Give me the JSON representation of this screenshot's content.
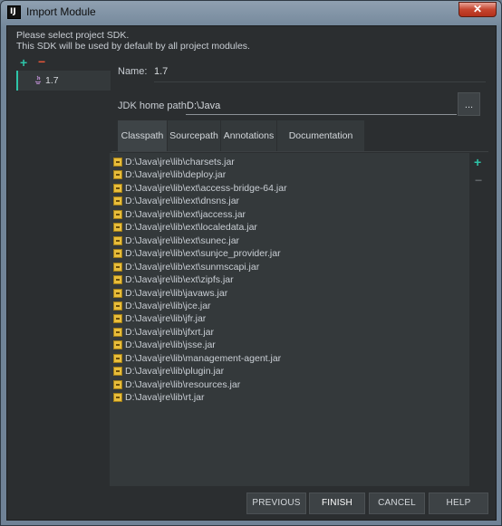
{
  "window": {
    "title": "Import Module",
    "app_icon_text": "IJ",
    "close_glyph": "✕"
  },
  "intro": {
    "line1": "Please select project SDK.",
    "line2": "This SDK will be used by default by all project modules."
  },
  "sdk_panel": {
    "add_glyph": "+",
    "remove_glyph": "−",
    "items": [
      {
        "label": "1.7",
        "icon": "java-sdk-icon",
        "selected": true
      }
    ]
  },
  "form": {
    "name_label": "Name:",
    "name_value": "1.7",
    "jdk_label": "JDK home path:",
    "jdk_value": "D:\\Java",
    "browse_label": "..."
  },
  "tabs": [
    {
      "label": "Classpath",
      "active": true
    },
    {
      "label": "Sourcepath",
      "active": false
    },
    {
      "label": "Annotations",
      "active": false
    },
    {
      "label": "Documentation Paths",
      "active": false
    }
  ],
  "classpath": [
    "D:\\Java\\jre\\lib\\charsets.jar",
    "D:\\Java\\jre\\lib\\deploy.jar",
    "D:\\Java\\jre\\lib\\ext\\access-bridge-64.jar",
    "D:\\Java\\jre\\lib\\ext\\dnsns.jar",
    "D:\\Java\\jre\\lib\\ext\\jaccess.jar",
    "D:\\Java\\jre\\lib\\ext\\localedata.jar",
    "D:\\Java\\jre\\lib\\ext\\sunec.jar",
    "D:\\Java\\jre\\lib\\ext\\sunjce_provider.jar",
    "D:\\Java\\jre\\lib\\ext\\sunmscapi.jar",
    "D:\\Java\\jre\\lib\\ext\\zipfs.jar",
    "D:\\Java\\jre\\lib\\javaws.jar",
    "D:\\Java\\jre\\lib\\jce.jar",
    "D:\\Java\\jre\\lib\\jfr.jar",
    "D:\\Java\\jre\\lib\\jfxrt.jar",
    "D:\\Java\\jre\\lib\\jsse.jar",
    "D:\\Java\\jre\\lib\\management-agent.jar",
    "D:\\Java\\jre\\lib\\plugin.jar",
    "D:\\Java\\jre\\lib\\resources.jar",
    "D:\\Java\\jre\\lib\\rt.jar"
  ],
  "path_toolbar": {
    "add_glyph": "+",
    "remove_glyph": "−"
  },
  "buttons": {
    "previous": "PREVIOUS",
    "finish": "FINISH",
    "cancel": "CANCEL",
    "help": "HELP"
  },
  "colors": {
    "accent": "#2ec4a8",
    "remove": "#e0553a",
    "background": "#2b2e30",
    "panel": "#34393b",
    "jar_icon": "#e8bd3a"
  }
}
